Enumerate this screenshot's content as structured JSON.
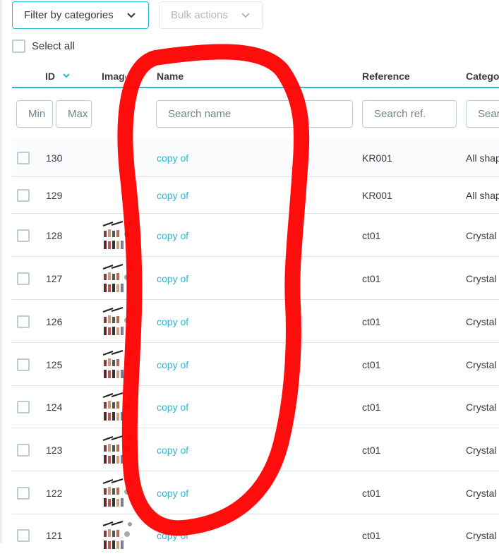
{
  "toolbar": {
    "filter_label": "Filter by categories",
    "bulk_label": "Bulk actions",
    "select_all_label": "Select all"
  },
  "table": {
    "headers": {
      "id": "ID",
      "image": "Image",
      "name": "Name",
      "reference": "Reference",
      "category": "Category"
    },
    "filters": {
      "id_min_placeholder": "Min",
      "id_max_placeholder": "Max",
      "name_placeholder": "Search name",
      "reference_placeholder": "Search ref.",
      "category_placeholder": "Search category"
    },
    "rows": [
      {
        "id": "130",
        "name": "copy of",
        "reference": "KR001",
        "category": "All shapes",
        "has_image": false
      },
      {
        "id": "129",
        "name": "copy of",
        "reference": "KR001",
        "category": "All shapes",
        "has_image": false
      },
      {
        "id": "128",
        "name": "copy of",
        "reference": "ct01",
        "category": "Crystal T",
        "has_image": true
      },
      {
        "id": "127",
        "name": "copy of",
        "reference": "ct01",
        "category": "Crystal T",
        "has_image": true
      },
      {
        "id": "126",
        "name": "copy of",
        "reference": "ct01",
        "category": "Crystal T",
        "has_image": true
      },
      {
        "id": "125",
        "name": "copy of",
        "reference": "ct01",
        "category": "Crystal T",
        "has_image": true
      },
      {
        "id": "124",
        "name": "copy of",
        "reference": "ct01",
        "category": "Crystal T",
        "has_image": true
      },
      {
        "id": "123",
        "name": "copy of",
        "reference": "ct01",
        "category": "Crystal T",
        "has_image": true
      },
      {
        "id": "122",
        "name": "copy of",
        "reference": "ct01",
        "category": "Crystal T",
        "has_image": true
      },
      {
        "id": "121",
        "name": "copy of",
        "reference": "ct01",
        "category": "Crystal T",
        "has_image": true
      }
    ]
  },
  "colors": {
    "accent": "#25b9d7",
    "text": "#363a41",
    "border": "#bbcdd2",
    "annotation": "#ff0000"
  },
  "icons": {
    "filter_chevron": "chevron-down-icon",
    "bulk_chevron": "chevron-down-icon",
    "sort": "sort-desc-icon"
  }
}
